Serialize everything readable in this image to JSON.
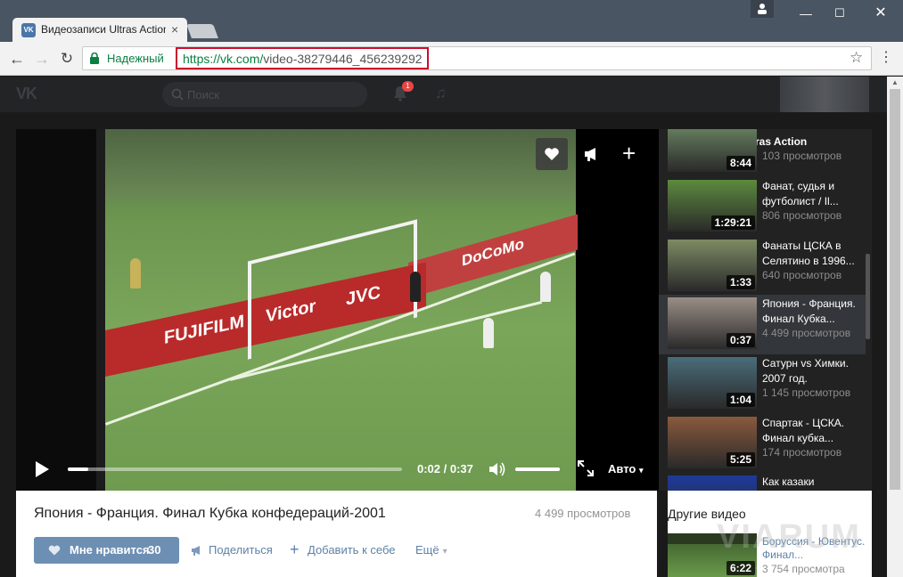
{
  "browser": {
    "tab_title": "Видеозаписи Ultras Action",
    "tab_favicon": "VK",
    "secure_label": "Надежный",
    "url_host": "https://vk.com/",
    "url_path": "video-38279446_456239292",
    "close_glyph": "×",
    "minimize_glyph": "—",
    "maximize_glyph": "☐",
    "window_close_glyph": "✕"
  },
  "vk_header": {
    "logo": "VK",
    "search_placeholder": "Поиск",
    "notifications_badge": "1"
  },
  "player": {
    "time": "0:02 / 0:37",
    "progress_fraction": 0.06,
    "volume_fraction": 1.0,
    "quality": "Авто",
    "billboard_words": [
      "FUJIFILM",
      "Victor",
      "JVC",
      "DoCoMo"
    ]
  },
  "playlist": {
    "title": "Видеозаписи Ultras Action",
    "items": [
      {
        "name": "",
        "views": "103 просмотров",
        "duration": "8:44",
        "thumb_color": "#6f8c67",
        "active": false
      },
      {
        "name": "Фанат, судья и футболист / Il...",
        "views": "806 просмотров",
        "duration": "1:29:21",
        "thumb_color": "#5d8a3e",
        "active": false
      },
      {
        "name": "Фанаты ЦСКА в Селятино в 1996...",
        "views": "640 просмотров",
        "duration": "1:33",
        "thumb_color": "#7d8b63",
        "active": false
      },
      {
        "name": "Япония - Франция. Финал Кубка...",
        "views": "4 499 просмотров",
        "duration": "0:37",
        "thumb_color": "#9a8e86",
        "active": true
      },
      {
        "name": "Сатурн vs Химки. 2007 год.",
        "views": "1 145 просмотров",
        "duration": "1:04",
        "thumb_color": "#4a6d7a",
        "active": false
      },
      {
        "name": "Спартак - ЦСКА. Финал кубка...",
        "views": "174 просмотров",
        "duration": "5:25",
        "thumb_color": "#8a5a3d",
        "active": false
      },
      {
        "name": "Как казаки",
        "views": "",
        "duration": "",
        "thumb_color": "#1e3a9a",
        "active": false
      }
    ]
  },
  "video_info": {
    "title": "Япония - Франция. Финал Кубка конфедераций-2001",
    "views": "4 499 просмотров",
    "like_label": "Мне нравится",
    "like_count": "30",
    "share_label": "Поделиться",
    "add_label": "Добавить к себе",
    "more_label": "Ещё"
  },
  "other_videos": {
    "title": "Другие видео",
    "item_name": "Боруссия - Ювентус. Финал...",
    "item_views": "3 754 просмотра",
    "item_duration": "6:22"
  },
  "watermark": "VIARUM",
  "colors": {
    "vk_blue": "#6d8fb3",
    "link_blue": "#5e81a8",
    "url_highlight": "#c8102e",
    "secure_green": "#0b8043"
  }
}
